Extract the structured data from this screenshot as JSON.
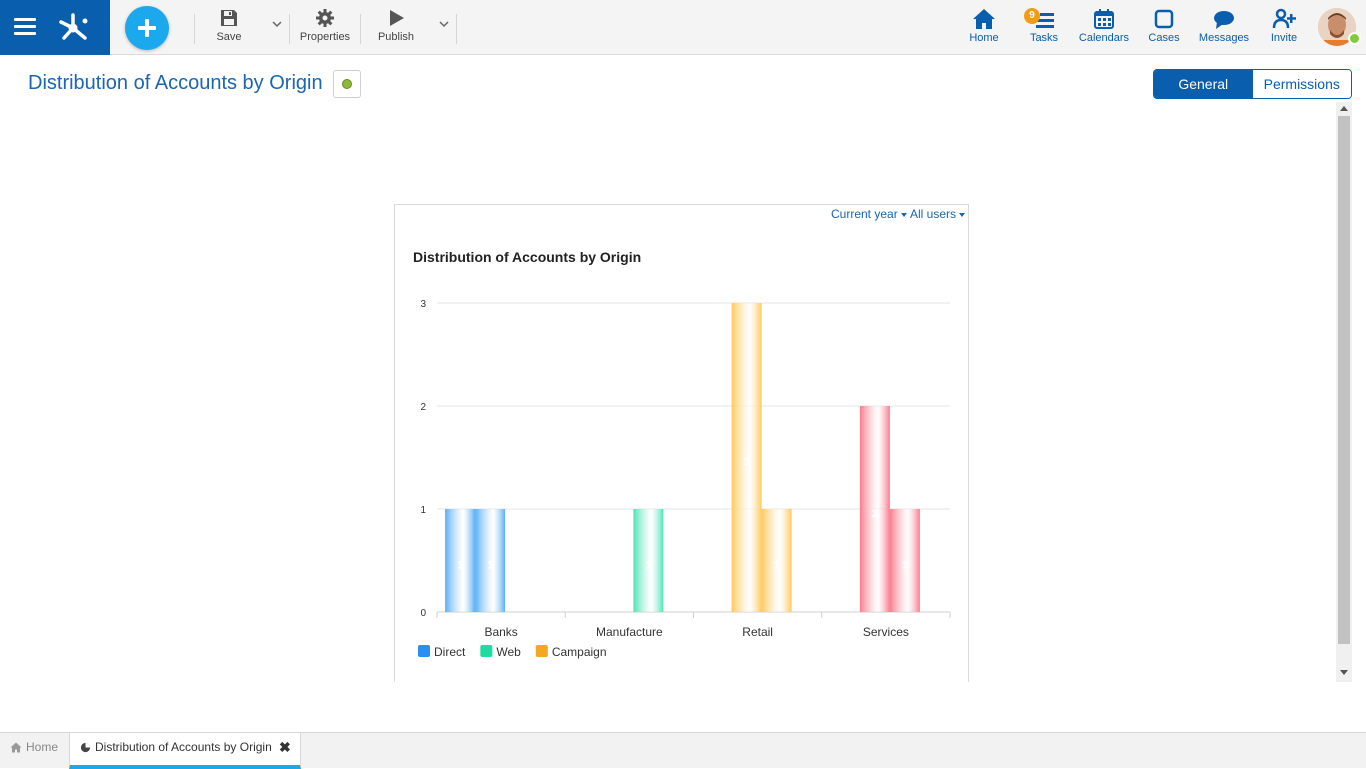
{
  "toolbar": {
    "save_label": "Save",
    "properties_label": "Properties",
    "publish_label": "Publish"
  },
  "nav": {
    "home_label": "Home",
    "tasks_label": "Tasks",
    "tasks_badge": "9",
    "calendars_label": "Calendars",
    "cases_label": "Cases",
    "messages_label": "Messages",
    "invite_label": "Invite"
  },
  "page": {
    "title": "Distribution of Accounts by Origin",
    "status_color": "#8fb83a"
  },
  "tabs": [
    {
      "label": "General",
      "active": true
    },
    {
      "label": "Permissions",
      "active": false
    }
  ],
  "widget": {
    "filter_period": "Current year",
    "filter_users": "All users"
  },
  "chart_data": {
    "type": "bar",
    "title": "Distribution of Accounts by Origin",
    "categories": [
      "Banks",
      "Manufacture",
      "Retail",
      "Services"
    ],
    "ylim": [
      0,
      3
    ],
    "yticks": [
      0,
      1,
      2,
      3
    ],
    "grid": true,
    "legend_placement": "bottom-left",
    "legend": [
      {
        "name": "Direct",
        "color": "#2a8ff0"
      },
      {
        "name": "Web",
        "color": "#1edca0"
      },
      {
        "name": "Campaign",
        "color": "#f5a623"
      }
    ],
    "bars": [
      {
        "category": "Banks",
        "value": 1,
        "color": "#5aaef5"
      },
      {
        "category": "Banks",
        "value": 1,
        "color": "#5aaef5"
      },
      {
        "category": "Manufacture",
        "value": 1,
        "color": "#4ee3b5"
      },
      {
        "category": "Retail",
        "value": 3,
        "color": "#ffc95c"
      },
      {
        "category": "Retail",
        "value": 1,
        "color": "#ffc95c"
      },
      {
        "category": "Services",
        "value": 2,
        "color": "#fb7a8d"
      },
      {
        "category": "Services",
        "value": 1,
        "color": "#fb7a8d"
      }
    ]
  },
  "bottom_tabs": {
    "home_label": "Home",
    "active_label": "Distribution of Accounts by Origin"
  }
}
